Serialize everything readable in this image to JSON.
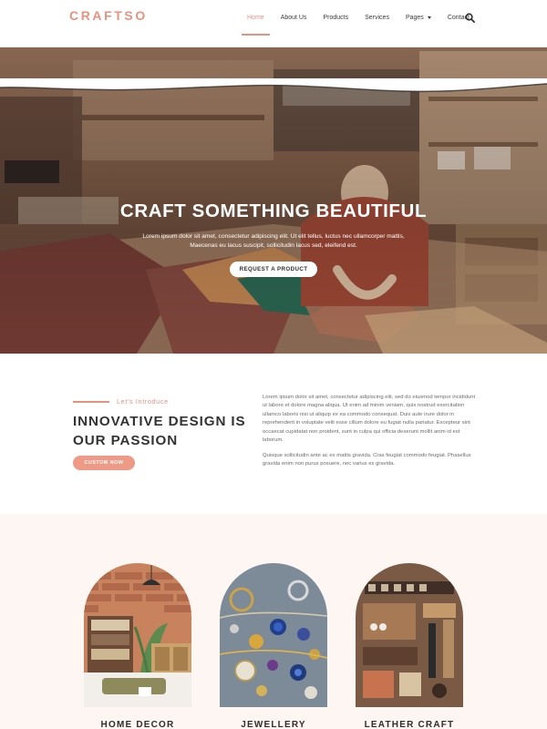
{
  "header": {
    "logo": "CRAFTSO",
    "nav": [
      {
        "label": "Home",
        "active": true
      },
      {
        "label": "About Us",
        "active": false
      },
      {
        "label": "Products",
        "active": false
      },
      {
        "label": "Services",
        "active": false
      },
      {
        "label": "Pages",
        "active": false,
        "has_dropdown": true
      },
      {
        "label": "Contact",
        "active": false
      }
    ],
    "search_icon": "search-icon"
  },
  "hero": {
    "title": "CRAFT SOMETHING BEAUTIFUL",
    "text": "Lorem ipsum dolor sit amet, consectetur adipiscing elit. Ut elit tellus, luctus nec ullamcorper mattis, Maecenas eu lacus suscipit, sollicitudin lacus sed, eleifend est.",
    "button": "REQUEST A PRODUCT"
  },
  "intro": {
    "eyebrow": "Let’s Introduce",
    "title": "INNOVATIVE DESIGN IS OUR PASSION",
    "button": "CUSTOM NOW",
    "paragraph1": "Lorem ipsum dolor sit amet, consectetur adipiscing elit, sed do eiusmod tempor incididunt ut labore et dolore magna aliqua. Ut enim ad minim veniam, quis nostrud exercitation ullamco laboris nisi ut aliquip ex ea commodo consequat. Duis aute irure dolor in reprehenderit in voluptate velit esse cillum dolore eu fugiat nulla pariatur. Excepteur sint occaecat cupidatat non proident, sunt in culpa qui officia deserunt mollit anim id est laborum.",
    "paragraph2": "Quisque sollicitudin ante ac ex mattis gravida. Cras feugiat commodo feugiat. Phasellus gravida enim non purus posuere, nec varius ex gravida."
  },
  "categories": [
    {
      "label": "HOME DECOR"
    },
    {
      "label": "JEWELLERY"
    },
    {
      "label": "LEATHER CRAFT"
    }
  ],
  "colors": {
    "accent": "#e8917f",
    "button_accent": "#ee9a86",
    "section_background": "#fdf6f2",
    "heading": "#333333"
  }
}
